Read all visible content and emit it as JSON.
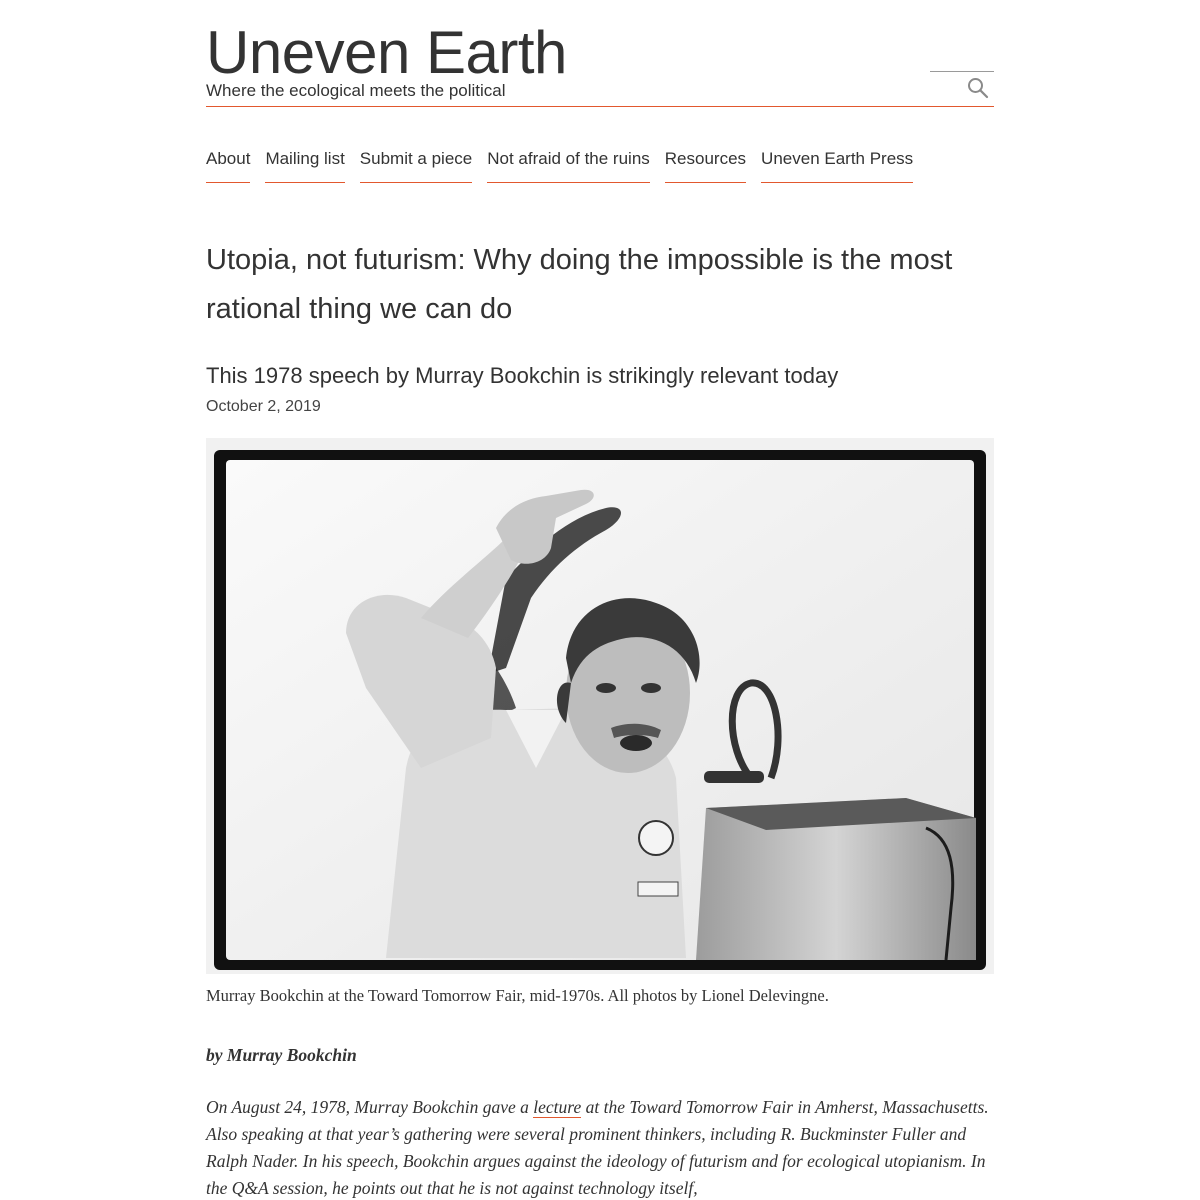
{
  "header": {
    "site_title": "Uneven Earth",
    "tagline": "Where the ecological meets the political",
    "search_icon": "search-icon"
  },
  "nav": {
    "items": [
      {
        "label": "About"
      },
      {
        "label": "Mailing list"
      },
      {
        "label": "Submit a piece"
      },
      {
        "label": "Not afraid of the ruins"
      },
      {
        "label": "Resources"
      },
      {
        "label": "Uneven Earth Press"
      }
    ]
  },
  "article": {
    "title": "Utopia, not futurism: Why doing the impossible is the most rational thing we can do",
    "subtitle": "This 1978 speech by Murray Bookchin is strikingly relevant today",
    "date": "October 2, 2019",
    "caption": "Murray Bookchin at the Toward Tomorrow Fair, mid-1970s. All photos by Lionel Delevingne.",
    "byline": "by Murray Bookchin",
    "intro": {
      "before_link": "On August 24, 1978, Murray Bookchin gave a ",
      "link_text": "lecture",
      "after_link": " at the Toward Tomorrow Fair in Amherst, Massachusetts. Also speaking at that year’s gathering were several prominent thinkers, including R. Buckminster Fuller and Ralph Nader. In his speech, Bookchin argues against the ideology of futurism and for ecological utopianism. In the Q&A session, he points out that he is not against technology itself,"
    }
  },
  "colors": {
    "accent": "#e2582e",
    "text": "#333333"
  }
}
